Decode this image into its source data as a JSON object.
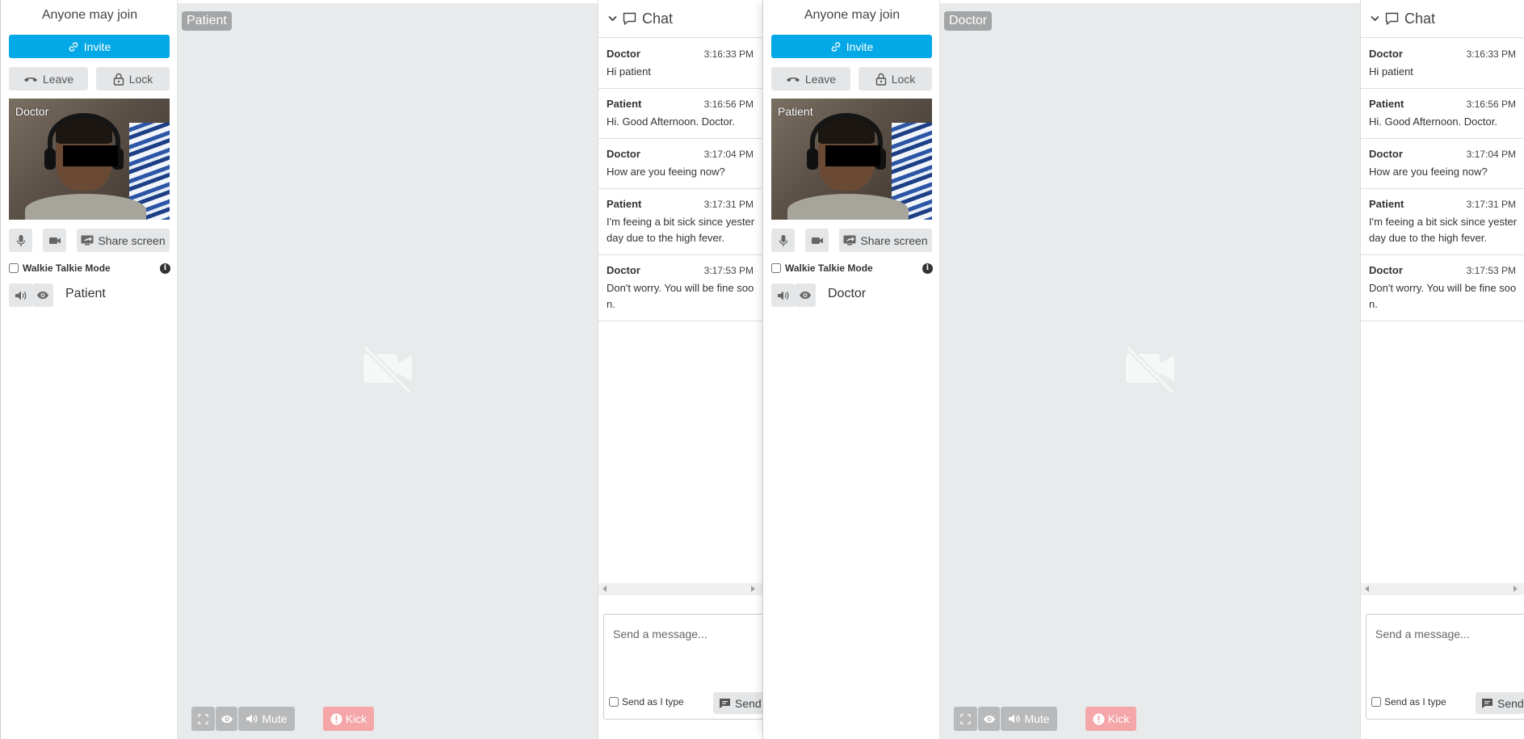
{
  "colors": {
    "invite": "#03a8e6",
    "kick": "#f4a6a8",
    "stage": "#e8eaeb",
    "button_grey": "#e4e6e8"
  },
  "panels": [
    {
      "sidebar": {
        "room_status": "Anyone may join",
        "invite_label": "Invite",
        "leave_label": "Leave",
        "lock_label": "Lock",
        "self_video_label": "Doctor",
        "share_screen_label": "Share screen",
        "walkie_talkie_label": "Walkie Talkie Mode",
        "peer_name": "Patient"
      },
      "stage": {
        "remote_label": "Patient",
        "mute_label": "Mute",
        "kick_label": "Kick"
      },
      "chat": {
        "title": "Chat",
        "messages": [
          {
            "author": "Doctor",
            "time": "3:16:33 PM",
            "text": "Hi patient"
          },
          {
            "author": "Patient",
            "time": "3:16:56 PM",
            "text": "Hi. Good Afternoon. Doctor."
          },
          {
            "author": "Doctor",
            "time": "3:17:04 PM",
            "text": "How are you feeing now?"
          },
          {
            "author": "Patient",
            "time": "3:17:31 PM",
            "text": "I'm feeing a bit sick since yesterday due to the high fever."
          },
          {
            "author": "Doctor",
            "time": "3:17:53 PM",
            "text": "Don't worry. You will be fine soon."
          }
        ],
        "input_placeholder": "Send a message...",
        "send_as_type_label": "Send as I type",
        "send_label": "Send"
      }
    },
    {
      "sidebar": {
        "room_status": "Anyone may join",
        "invite_label": "Invite",
        "leave_label": "Leave",
        "lock_label": "Lock",
        "self_video_label": "Patient",
        "share_screen_label": "Share screen",
        "walkie_talkie_label": "Walkie Talkie Mode",
        "peer_name": "Doctor"
      },
      "stage": {
        "remote_label": "Doctor",
        "mute_label": "Mute",
        "kick_label": "Kick"
      },
      "chat": {
        "title": "Chat",
        "messages": [
          {
            "author": "Doctor",
            "time": "3:16:33 PM",
            "text": "Hi patient"
          },
          {
            "author": "Patient",
            "time": "3:16:56 PM",
            "text": "Hi. Good Afternoon. Doctor."
          },
          {
            "author": "Doctor",
            "time": "3:17:04 PM",
            "text": "How are you feeing now?"
          },
          {
            "author": "Patient",
            "time": "3:17:31 PM",
            "text": "I'm feeing a bit sick since yesterday due to the high fever."
          },
          {
            "author": "Doctor",
            "time": "3:17:53 PM",
            "text": "Don't worry. You will be fine soon."
          }
        ],
        "input_placeholder": "Send a message...",
        "send_as_type_label": "Send as I type",
        "send_label": "Send"
      }
    }
  ]
}
